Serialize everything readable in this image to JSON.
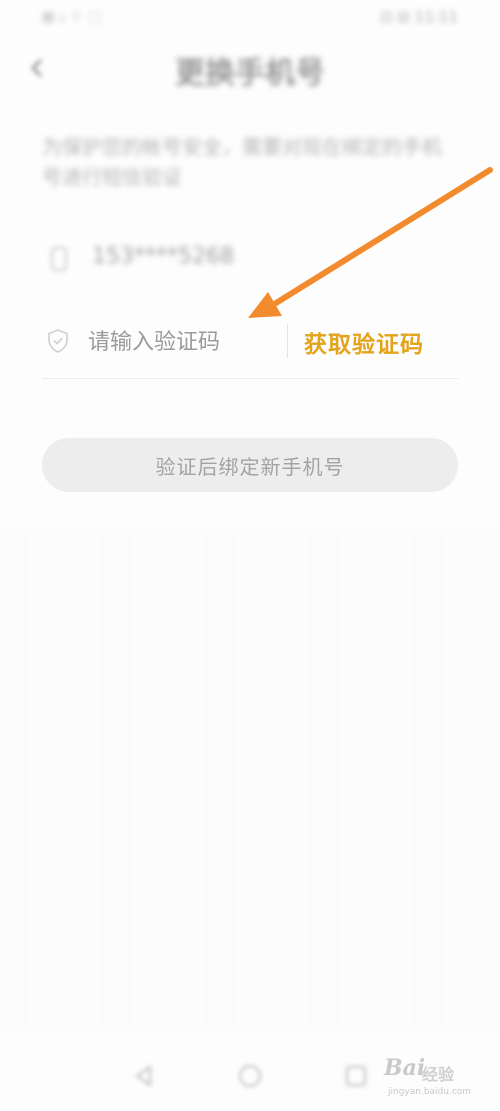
{
  "status_bar": {
    "left": "⊠ ᵢₗ ⌔ ⬚",
    "right": "⊡ ⊟ 11:11"
  },
  "header": {
    "title": "更换手机号",
    "back_icon": "chevron-left-icon"
  },
  "notice": {
    "text": "为保护您的帐号安全，需要对现在绑定的手机号进行短信验证"
  },
  "phone": {
    "icon": "phone-icon",
    "value": "153****5268"
  },
  "code_field": {
    "icon": "shield-icon",
    "value": "",
    "placeholder": "请输入验证码",
    "get_code_label": "获取验证码",
    "accent_color": "#e3a31a"
  },
  "bind_button": {
    "label": "验证后绑定新手机号",
    "background": "#ededed"
  },
  "annotation": {
    "arrow_color": "#f28a2e"
  },
  "nav_bar": {
    "icons": [
      "back-triangle-icon",
      "home-circle-icon",
      "recent-square-icon"
    ]
  },
  "watermark": {
    "brand": "Bai",
    "sub": "经验",
    "url": "jingyan.baidu.com"
  }
}
